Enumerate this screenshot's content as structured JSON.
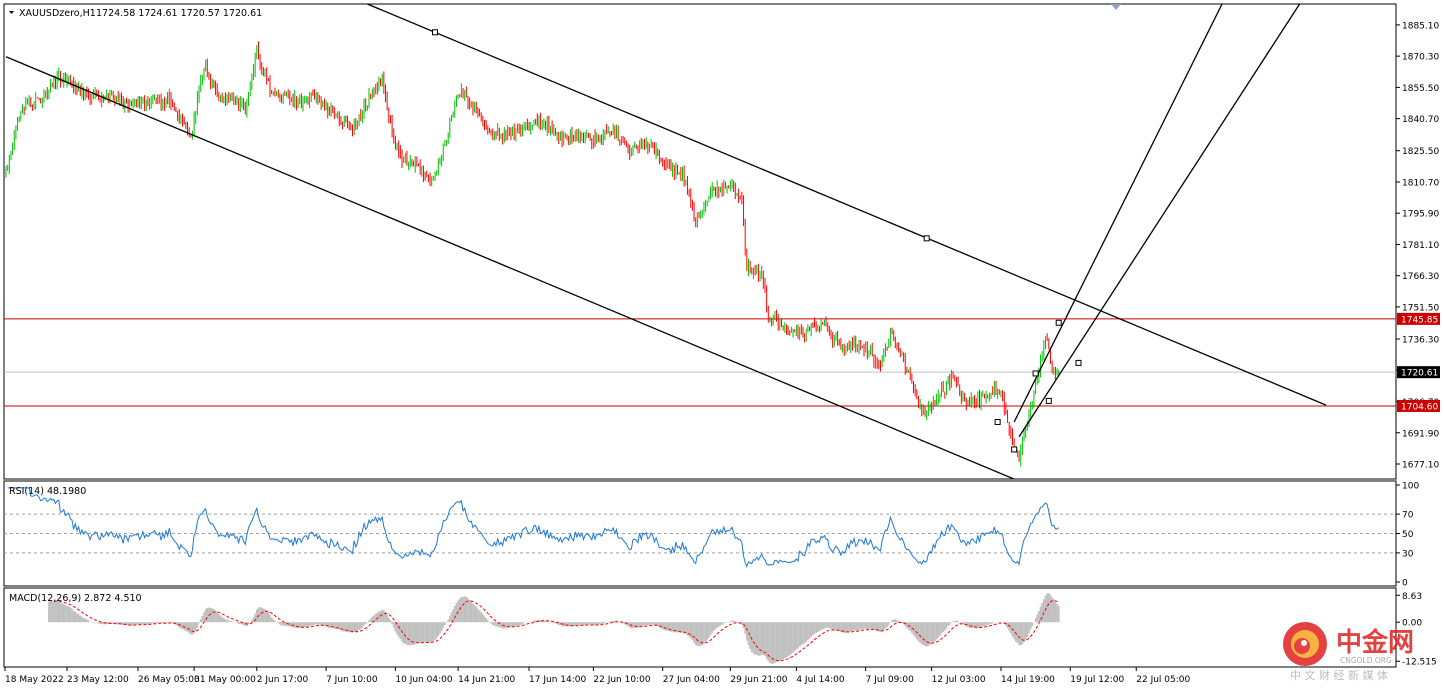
{
  "chart_data": [
    {
      "type": "candlestick",
      "panel": "price",
      "title": "XAUUSDzero,H1",
      "ohlc": [
        "1724.58",
        "1724.61",
        "1720.57",
        "1720.61"
      ],
      "ylim": [
        1670,
        1895
      ],
      "y_ticks": [
        "1885.10",
        "1870.30",
        "1855.50",
        "1840.70",
        "1825.50",
        "1810.70",
        "1795.90",
        "1781.10",
        "1766.30",
        "1751.50",
        "1736.30",
        "1721.50",
        "1706.70",
        "1691.90",
        "1677.10"
      ],
      "horizontal_lines": [
        {
          "label": "1745.85",
          "value": 1745.85,
          "color": "#cc0000",
          "badge_bg": "#cc0000",
          "badge_fg": "#ffffff"
        },
        {
          "label": "1720.61",
          "value": 1720.61,
          "color": "#c0c0c0",
          "badge_bg": "#000000",
          "badge_fg": "#ffffff"
        },
        {
          "label": "1704.60",
          "value": 1704.6,
          "color": "#cc0000",
          "badge_bg": "#cc0000",
          "badge_fg": "#ffffff"
        }
      ],
      "anchors": [
        {
          "bar": 0,
          "price": 1815
        },
        {
          "bar": 10,
          "price": 1845
        },
        {
          "bar": 30,
          "price": 1858
        },
        {
          "bar": 45,
          "price": 1855
        },
        {
          "bar": 60,
          "price": 1848
        },
        {
          "bar": 75,
          "price": 1850
        },
        {
          "bar": 88,
          "price": 1845
        },
        {
          "bar": 100,
          "price": 1852
        },
        {
          "bar": 112,
          "price": 1830
        },
        {
          "bar": 120,
          "price": 1865
        },
        {
          "bar": 130,
          "price": 1853
        },
        {
          "bar": 145,
          "price": 1843
        },
        {
          "bar": 152,
          "price": 1875
        },
        {
          "bar": 162,
          "price": 1852
        },
        {
          "bar": 172,
          "price": 1848
        },
        {
          "bar": 184,
          "price": 1853
        },
        {
          "bar": 196,
          "price": 1843
        },
        {
          "bar": 210,
          "price": 1838
        },
        {
          "bar": 228,
          "price": 1857
        },
        {
          "bar": 238,
          "price": 1825
        },
        {
          "bar": 250,
          "price": 1815
        },
        {
          "bar": 258,
          "price": 1812
        },
        {
          "bar": 275,
          "price": 1852
        },
        {
          "bar": 290,
          "price": 1840
        },
        {
          "bar": 303,
          "price": 1830
        },
        {
          "bar": 320,
          "price": 1842
        },
        {
          "bar": 334,
          "price": 1830
        },
        {
          "bar": 345,
          "price": 1835
        },
        {
          "bar": 358,
          "price": 1828
        },
        {
          "bar": 368,
          "price": 1838
        },
        {
          "bar": 378,
          "price": 1825
        },
        {
          "bar": 390,
          "price": 1828
        },
        {
          "bar": 402,
          "price": 1820
        },
        {
          "bar": 410,
          "price": 1812
        },
        {
          "bar": 418,
          "price": 1792
        },
        {
          "bar": 428,
          "price": 1808
        },
        {
          "bar": 440,
          "price": 1808
        },
        {
          "bar": 446,
          "price": 1800
        },
        {
          "bar": 449,
          "price": 1772
        },
        {
          "bar": 458,
          "price": 1768
        },
        {
          "bar": 462,
          "price": 1745
        },
        {
          "bar": 470,
          "price": 1742
        },
        {
          "bar": 485,
          "price": 1741
        },
        {
          "bar": 496,
          "price": 1740
        },
        {
          "bar": 508,
          "price": 1735
        },
        {
          "bar": 520,
          "price": 1730
        },
        {
          "bar": 530,
          "price": 1725
        },
        {
          "bar": 536,
          "price": 1742
        },
        {
          "bar": 543,
          "price": 1728
        },
        {
          "bar": 548,
          "price": 1715
        },
        {
          "bar": 556,
          "price": 1702
        },
        {
          "bar": 562,
          "price": 1708
        },
        {
          "bar": 574,
          "price": 1716
        },
        {
          "bar": 580,
          "price": 1708
        },
        {
          "bar": 592,
          "price": 1709
        },
        {
          "bar": 603,
          "price": 1710
        },
        {
          "bar": 608,
          "price": 1692
        },
        {
          "bar": 614,
          "price": 1683
        },
        {
          "bar": 620,
          "price": 1700
        },
        {
          "bar": 625,
          "price": 1716
        },
        {
          "bar": 630,
          "price": 1735
        },
        {
          "bar": 634,
          "price": 1722
        },
        {
          "bar": 638,
          "price": 1720.61
        }
      ],
      "trendlines": [
        {
          "p1": [
            0,
            1870
          ],
          "p2": [
            620,
            1667
          ],
          "color": "#000000"
        },
        {
          "p1": [
            219,
            1895
          ],
          "p2": [
            800,
            1705
          ],
          "color": "#000000",
          "markers": [
            [
              260,
              1881.6
            ],
            [
              558,
              1784.0
            ]
          ]
        },
        {
          "p1": [
            611,
            1697
          ],
          "p2": [
            737,
            1895
          ],
          "color": "#000000",
          "markers": [
            [
              601,
              1697
            ],
            [
              624,
              1720
            ],
            [
              638,
              1744
            ]
          ]
        },
        {
          "p1": [
            614,
            1690
          ],
          "p2": [
            784,
            1895
          ],
          "color": "#000000",
          "markers": [
            [
              611,
              1684
            ],
            [
              632,
              1707
            ],
            [
              650,
              1725
            ]
          ]
        }
      ]
    },
    {
      "type": "line",
      "panel": "rsi",
      "title": "RSI(14) 48.1980",
      "ylim": [
        0,
        100
      ],
      "y_ticks": [
        "100",
        "70",
        "50",
        "30",
        "0"
      ],
      "levels": [
        70,
        30
      ],
      "color": "#1e78d7",
      "current": 48.198
    },
    {
      "type": "histogram",
      "panel": "macd",
      "title": "MACD(12,26,9) 2.872 4.510",
      "main": 2.872,
      "signal": 4.51,
      "y_ticks": [
        "8.63",
        "0.00",
        "-12.515"
      ],
      "ylim": [
        -13.4,
        10
      ],
      "hist_color": "#c0c0c0",
      "signal_color": "#ff0000"
    }
  ],
  "time_labels": [
    {
      "label": "18 May 2022",
      "bar": 0
    },
    {
      "label": "23 May 12:00",
      "bar": 37
    },
    {
      "label": "26 May 05:00",
      "bar": 80
    },
    {
      "label": "31 May 00:00",
      "bar": 114
    },
    {
      "label": "2 Jun 17:00",
      "bar": 152
    },
    {
      "label": "7 Jun 10:00",
      "bar": 194
    },
    {
      "label": "10 Jun 04:00",
      "bar": 236
    },
    {
      "label": "14 Jun 21:00",
      "bar": 274
    },
    {
      "label": "17 Jun 14:00",
      "bar": 317
    },
    {
      "label": "22 Jun 10:00",
      "bar": 356
    },
    {
      "label": "27 Jun 04:00",
      "bar": 398
    },
    {
      "label": "29 Jun 21:00",
      "bar": 439
    },
    {
      "label": "4 Jul 14:00",
      "bar": 479
    },
    {
      "label": "7 Jul 09:00",
      "bar": 521
    },
    {
      "label": "12 Jul 03:00",
      "bar": 561
    },
    {
      "label": "14 Jul 19:00",
      "bar": 603
    },
    {
      "label": "19 Jul 12:00",
      "bar": 645
    },
    {
      "label": "22 Jul 05:00",
      "bar": 685
    }
  ],
  "colors": {
    "bull": "#00c000",
    "bear": "#ff0000",
    "axis": "#000000",
    "grid_level": "#a0a0a0",
    "wm_red": "#e02020",
    "wm_orange": "#f5a623"
  },
  "watermark": {
    "brand": "中金网",
    "domain": "CNGOLD.ORG",
    "slogan": "中 文 财 经 新 媒 体"
  }
}
